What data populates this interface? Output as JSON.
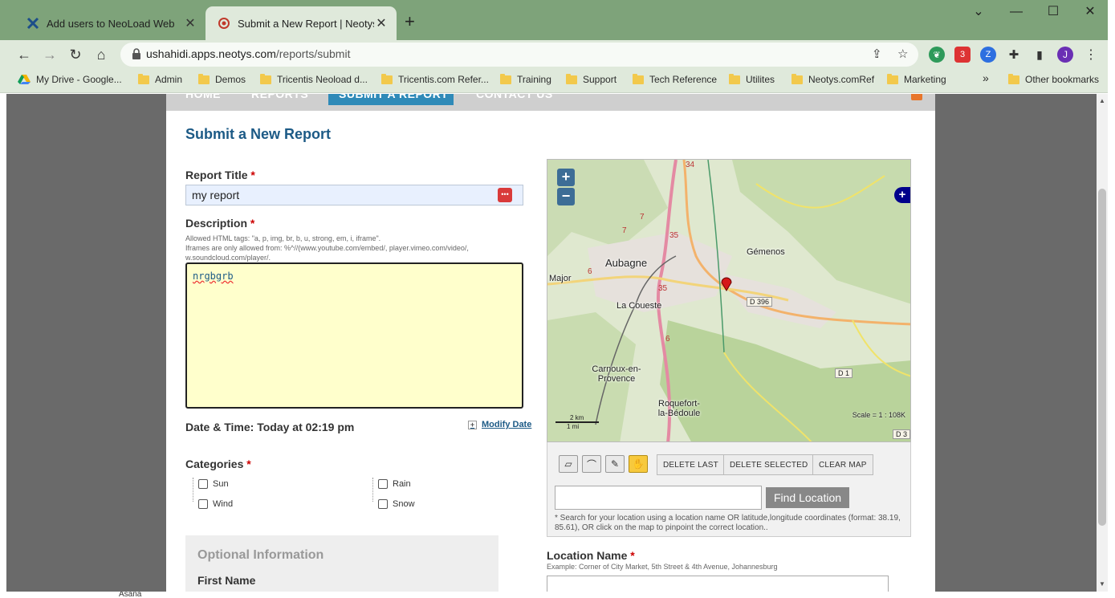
{
  "browser": {
    "tabs": [
      {
        "title": "Add users to NeoLoad Web",
        "active": false
      },
      {
        "title": "Submit a New Report | Neotys U",
        "active": true
      }
    ],
    "url_host": "ushahidi.apps.neotys.com",
    "url_path": "/reports/submit",
    "profile_initial": "J",
    "ext_badge": "3",
    "bookmarks": [
      "My Drive - Google...",
      "Admin",
      "Demos",
      "Tricentis Neoload d...",
      "Tricentis.com Refer...",
      "Training",
      "Support",
      "Tech Reference",
      "Utilites",
      "Neotys.comRef",
      "Marketing"
    ],
    "more_bookmarks": "»",
    "other_bookmarks": "Other bookmarks"
  },
  "site_nav": {
    "items": [
      "HOME",
      "REPORTS",
      "SUBMIT A REPORT",
      "CONTACT US"
    ]
  },
  "form": {
    "heading": "Submit a New Report",
    "title_label": "Report Title",
    "title_value": "my report",
    "required_mark": "*",
    "description_label": "Description",
    "allowed_tags_note": "Allowed HTML tags: \"a, p, img, br, b, u, strong, em, i, iframe\".",
    "iframes_note": "Iframes are only allowed from: %^//(www.youtube.com/embed/, player.vimeo.com/video/, w.soundcloud.com/player/.",
    "description_value": "nrgbgrb",
    "datetime_label": "Date & Time: Today at 02:19 pm",
    "modify_date": "Modify Date",
    "categories_label": "Categories",
    "categories": [
      "Sun",
      "Wind",
      "Rain",
      "Snow"
    ],
    "optional_title": "Optional Information",
    "first_name_label": "First Name"
  },
  "map": {
    "places": [
      "Aubagne",
      "Gémenos",
      "Major",
      "La Coueste",
      "Carnoux-en-Provence",
      "Roquefort-la-Bédoule"
    ],
    "roads": [
      "D 396",
      "D 1",
      "D 3"
    ],
    "route_numbers": [
      "34",
      "35",
      "35",
      "7",
      "7",
      "6",
      "6"
    ],
    "scale": "Scale = 1 : 108K",
    "scalebar_km": "2 km",
    "scalebar_mi": "1 mi",
    "zoom_in": "+",
    "zoom_out": "−",
    "buttons": [
      "DELETE LAST",
      "DELETE SELECTED",
      "CLEAR MAP"
    ],
    "find_button": "Find Location",
    "find_note": "* Search for your location using a location name OR latitude,longitude coordinates (format: 38.19, 85.61), OR click on the map to pinpoint the correct location.."
  },
  "location": {
    "label": "Location Name",
    "example": "Example: Corner of City Market, 5th Street & 4th Avenue, Johannesburg"
  },
  "background_text": {
    "bottom_left": "Asana"
  }
}
